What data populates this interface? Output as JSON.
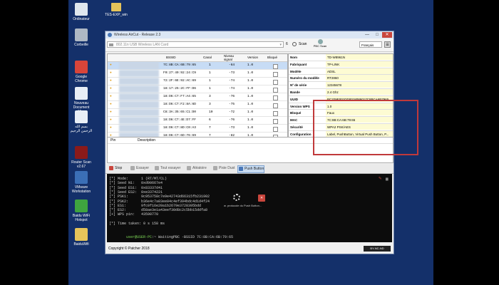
{
  "desktop": {
    "icons": [
      {
        "label": "Ordinateur",
        "color": "#dfe7ee"
      },
      {
        "label": "Corbeille",
        "color": "#aeb8c4"
      },
      {
        "label": "Google Chrome",
        "color": "#d8453a"
      },
      {
        "label": "Nouveau Document Mi...",
        "color": "#e8eef6"
      },
      {
        "label": "بسم الله الرحمن الرحيم",
        "color": "#e8eef6"
      },
      {
        "label": "Router Scan v2.67",
        "color": "#8b1a1a"
      },
      {
        "label": "VMware Workstation",
        "color": "#3b6fb6"
      },
      {
        "label": "Baidu WiFi Hotspot",
        "color": "#3fa43f"
      },
      {
        "label": "BaiduWifi",
        "color": "#e6c45a"
      }
    ],
    "folder_label": "TES-EXP_win"
  },
  "window": {
    "title": "Wireless AirCut - Release 2.3",
    "minimize": "—",
    "maximize": "□",
    "close": "✕",
    "adapter_placeholder": "802.11n USB Wireless LAN Card",
    "adapter_count": "6",
    "scan_label": "Scan",
    "pbc_scan_label": "PBC Scan",
    "language": "Français",
    "columns": {
      "bssid": "BSSID",
      "channel": "Canal",
      "signal": "Niveau signal",
      "version": "Version",
      "blocked": "Bloqué"
    },
    "networks": [
      {
        "bssid": "7C:8B:CA:6B:79:65",
        "channel": "1",
        "signal": "-64",
        "version": "1.0"
      },
      {
        "bssid": "F0:27:49:92:24:C9",
        "channel": "1",
        "signal": "-73",
        "version": "1.0"
      },
      {
        "bssid": "72:2F:6E:92:AC:69",
        "channel": "1",
        "signal": "-74",
        "version": "1.0"
      },
      {
        "bssid": "18:17:25:2C:FF:D6",
        "channel": "1",
        "signal": "-74",
        "version": "1.0"
      },
      {
        "bssid": "18:D6:C7:F7:A4:65",
        "channel": "3",
        "signal": "-76",
        "version": "1.0"
      },
      {
        "bssid": "18:D6:C7:F2:8A:6D",
        "channel": "3",
        "signal": "-75",
        "version": "1.0"
      },
      {
        "bssid": "C8:3A:35:65:C1:D0",
        "channel": "10",
        "signal": "-72",
        "version": "1.0"
      },
      {
        "bssid": "18:D6:C7:4E:D7:FF",
        "channel": "6",
        "signal": "-76",
        "version": "1.0"
      },
      {
        "bssid": "18:D6:C7:8D:C0:A3",
        "channel": "7",
        "signal": "-73",
        "version": "1.0"
      },
      {
        "bssid": "18:D6:C7:6D:76:69",
        "channel": "7",
        "signal": "-82",
        "version": "1.0"
      }
    ],
    "props": [
      {
        "k": "Nom",
        "v": "TD-W8961N"
      },
      {
        "k": "Fabriquant",
        "v": "TP-LINK"
      },
      {
        "k": "Modèle",
        "v": "ADSL"
      },
      {
        "k": "Numéro du modèle",
        "v": "RT2860"
      },
      {
        "k": "Nº de série",
        "v": "12345678"
      },
      {
        "k": "Bande",
        "v": "2.4 Ghz"
      },
      {
        "k": "UUID",
        "v": "BC329E001DD0018086017C8BCA6B7965"
      },
      {
        "k": "Version WPS",
        "v": "1.0"
      },
      {
        "k": "Bloqué",
        "v": "Faux"
      },
      {
        "k": "MAC",
        "v": "7C:8B:CA:6B:79:65"
      },
      {
        "k": "Sécurité",
        "v": "WPA2 PSK/AES"
      },
      {
        "k": "Configuration",
        "v": "Label, PushButton, Virtual Push Button, P..."
      },
      {
        "k": "PIN WPS",
        "v": ""
      },
      {
        "k": "Clef du réseau",
        "v": ""
      }
    ],
    "pin_header": "Pin",
    "description_header": "Description",
    "toolbar2": {
      "stop": "Stop",
      "essayer": "Essayer",
      "tout_essayer": "Tout essayer",
      "aleatoire": "Aléatoire",
      "pixie_dust": "Pixie Dust",
      "push_button": "Push Button"
    },
    "console_lines": [
      "[*] Mode:      1 (RT/MT/CL)",
      "[*] Seed N1:   0xd90667e4",
      "[*] Seed ES1:  0x83337d41",
      "[*] Seed ES2:  0xe3374221",
      "[*] PSK1:      9c953758c7e9e42743d66315fb231902",
      "[*] PSK2:      b36e4c7a03ee04c4ef394bdc4d1d4f24",
      "[*] ES1:       9fc0f16e20a1b2679e3728395bdd",
      "[*] ES2:       d58ae3e1a43eef30d8c2c5bb15ddfa8",
      "[+] WPS pin:   43590770",
      "",
      "[*] Time taken: 0 s 158 ms"
    ],
    "prompt_user": "user@USER-PC",
    "prompt_cmd": ":~ WaitingPBC -BSSID 7C:8B:CA:6B:79:65",
    "spinner_text": "w. protocole du Push Button...",
    "copyright": "Copyright © Patcher 2018",
    "license_badge": "BY-NC-ND"
  }
}
